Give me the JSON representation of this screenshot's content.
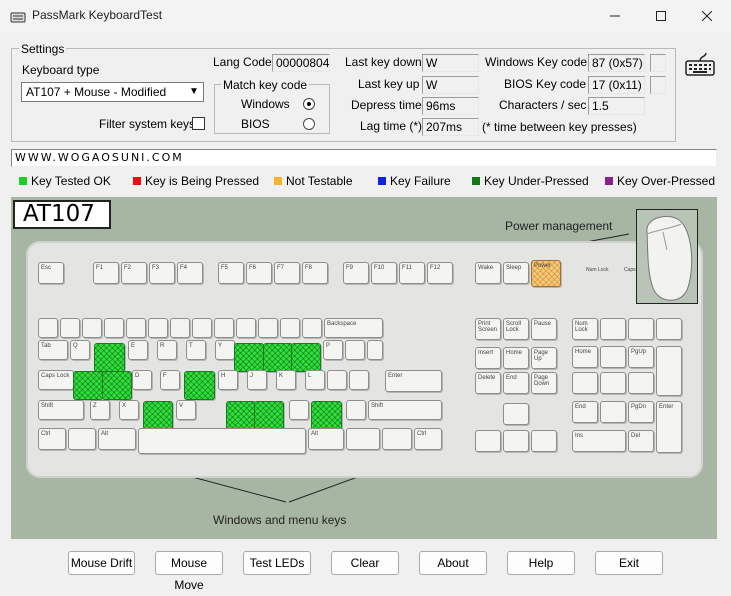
{
  "window": {
    "title": "PassMark KeyboardTest",
    "minimize_icon": "minimize-icon",
    "maximize_icon": "maximize-icon",
    "close_icon": "close-icon"
  },
  "settings": {
    "group_label": "Settings",
    "keyboard_type_label": "Keyboard type",
    "keyboard_type_value": "AT107 + Mouse - Modified",
    "filter_label": "Filter system keys",
    "lang_code_label": "Lang Code",
    "lang_code_value": "00000804",
    "match_key_label": "Match key code",
    "windows_label": "Windows",
    "bios_label": "BIOS",
    "last_key_down_label": "Last key down",
    "last_key_down_value": "W",
    "last_key_up_label": "Last key up",
    "last_key_up_value": "W",
    "depress_time_label": "Depress time",
    "depress_time_value": "96ms",
    "lag_time_label": "Lag time (*)",
    "lag_time_value": "207ms",
    "lag_note": "(* time between key presses)",
    "win_key_code_label": "Windows Key code",
    "win_key_code_value": "87 (0x57)",
    "bios_key_code_label": "BIOS Key code",
    "bios_key_code_value": "17 (0x11)",
    "chars_per_sec_label": "Characters / sec",
    "chars_per_sec_value": "1.5"
  },
  "typed_text": "WWW.WOGAOSUNI.COM",
  "legend": [
    {
      "label": "Key Tested OK",
      "color": "#22cc22"
    },
    {
      "label": "Key is Being Pressed",
      "color": "#ee1111"
    },
    {
      "label": "Not Testable",
      "color": "#f5b335"
    },
    {
      "label": "Key Failure",
      "color": "#1122dd"
    },
    {
      "label": "Key Under-Pressed",
      "color": "#117711"
    },
    {
      "label": "Key Over-Pressed",
      "color": "#882288"
    }
  ],
  "keyboard": {
    "model": "AT107",
    "power_label": "Power management",
    "winkeys_label": "Windows and menu keys",
    "keys": {
      "esc": "Esc",
      "f1": "F1",
      "f2": "F2",
      "f3": "F3",
      "f4": "F4",
      "f5": "F5",
      "f6": "F6",
      "f7": "F7",
      "f8": "F8",
      "f9": "F9",
      "f10": "F10",
      "f11": "F11",
      "f12": "F12",
      "wake": "Wake",
      "sleep": "Sleep",
      "power": "Power",
      "tab": "Tab",
      "caps": "Caps Lock",
      "shift": "Shift",
      "ctrl": "Ctrl",
      "alt": "Alt",
      "q": "Q",
      "e": "E",
      "r": "R",
      "t": "T",
      "y": "Y",
      "p": "P",
      "d": "D",
      "f": "F",
      "h": "H",
      "j": "J",
      "k": "K",
      "l": "L",
      "z": "Z",
      "x": "X",
      "v": "V",
      "backspace": "Backspace",
      "enter": "Enter",
      "prt": "Print Screen",
      "scrl": "Scroll Lock",
      "pause": "Pause",
      "ins": "Insert",
      "home": "Home",
      "pgup": "Page Up",
      "del": "Delete",
      "end": "End",
      "pgdn": "Page Down",
      "numlk": "Num Lock",
      "kp_home": "Home",
      "kp_pgup": "PgUp",
      "kp_end": "End",
      "kp_pgdn": "PgDn",
      "kp_ins": "Ins",
      "kp_del": "Del",
      "kp_enter": "Enter",
      "num_led": "Num Lock",
      "caps_led": "Caps Lock"
    }
  },
  "buttons": {
    "mouse_drift": "Mouse Drift",
    "mouse_move": "Mouse Move",
    "test_leds": "Test LEDs",
    "clear": "Clear",
    "about": "About",
    "help": "Help",
    "exit": "Exit"
  }
}
